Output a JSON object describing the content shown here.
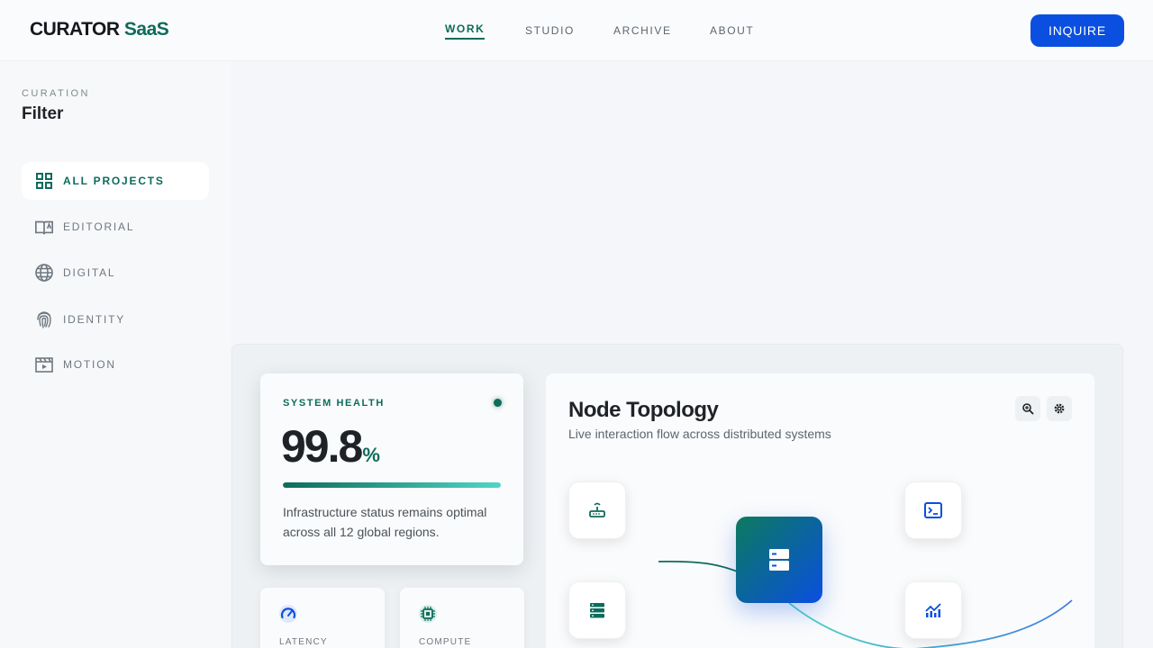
{
  "header": {
    "brand_main": "CURATOR",
    "brand_accent": "SaaS",
    "nav": [
      "WORK",
      "STUDIO",
      "ARCHIVE",
      "ABOUT"
    ],
    "active_nav": "WORK",
    "cta": "INQUIRE"
  },
  "sidebar": {
    "kicker": "CURATION",
    "title": "Filter",
    "items": [
      {
        "label": "ALL PROJECTS",
        "icon": "grid-icon",
        "active": true
      },
      {
        "label": "EDITORIAL",
        "icon": "book-icon",
        "active": false
      },
      {
        "label": "DIGITAL",
        "icon": "globe-icon",
        "active": false
      },
      {
        "label": "IDENTITY",
        "icon": "fingerprint-icon",
        "active": false
      },
      {
        "label": "MOTION",
        "icon": "film-icon",
        "active": false
      }
    ]
  },
  "health": {
    "kicker": "SYSTEM HEALTH",
    "value": "99.8",
    "unit": "%",
    "progress": 1.0,
    "description": "Infrastructure status remains optimal across all 12 global regions."
  },
  "mini_cards": [
    {
      "label": "LATENCY",
      "icon": "speedometer-icon"
    },
    {
      "label": "COMPUTE",
      "icon": "chip-icon"
    }
  ],
  "topology": {
    "title": "Node Topology",
    "subtitle": "Live interaction flow across distributed systems",
    "tools": [
      "zoom-in-icon",
      "settings-icon"
    ],
    "nodes": [
      "router-icon",
      "storage-icon",
      "terminal-icon",
      "analytics-icon"
    ],
    "hub": "server-icon"
  },
  "colors": {
    "primary_green": "#0e6b5c",
    "primary_blue": "#0a4fe0",
    "background": "#f4f6f9"
  }
}
